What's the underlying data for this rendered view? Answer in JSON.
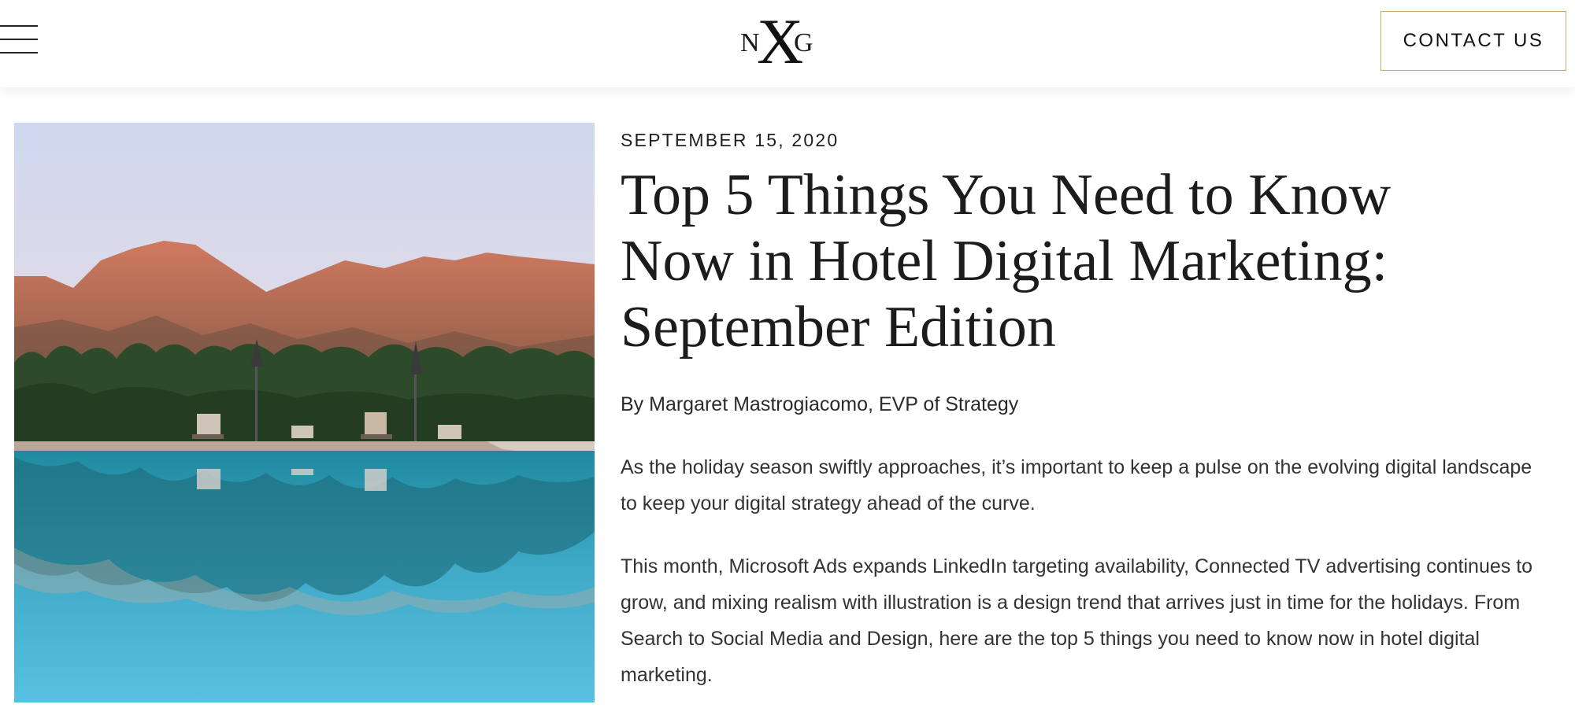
{
  "header": {
    "menu_icon": "hamburger-menu-icon",
    "logo": {
      "left": "N",
      "center": "X",
      "right": "G"
    },
    "contact_label": "CONTACT US",
    "accent_color": "#c9a86a"
  },
  "hero": {
    "image_subject": "infinity pool with mountain reflection"
  },
  "article": {
    "date": "SEPTEMBER 15, 2020",
    "title": "Top 5 Things You Need to Know Now in Hotel Digital Marketing: September Edition",
    "byline": "By Margaret Mastrogiacomo, EVP of Strategy",
    "paragraphs": [
      "As the holiday season swiftly approaches, it’s important to keep a pulse on the evolving digital landscape to keep your digital strategy ahead of the curve.",
      "This month, Microsoft Ads expands LinkedIn targeting availability, Connected TV advertising continues to grow, and mixing realism with illustration is a design trend that arrives just in time for the holidays. From Search to Social Media and Design, here are the top 5 things you need to know now in hotel digital marketing."
    ]
  }
}
